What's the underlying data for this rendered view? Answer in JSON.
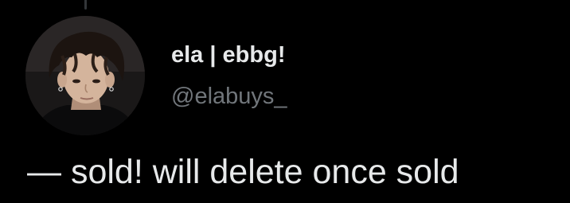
{
  "tweet": {
    "author": {
      "display_name": "ela | ebbg!",
      "handle": "@elabuys_"
    },
    "text": "— sold! will delete once sold"
  },
  "icons": {
    "avatar": "profile-photo"
  },
  "colors": {
    "background": "#000000",
    "primary_text": "#e7e9ea",
    "secondary_text": "#71767b",
    "thread_line": "#333639"
  }
}
